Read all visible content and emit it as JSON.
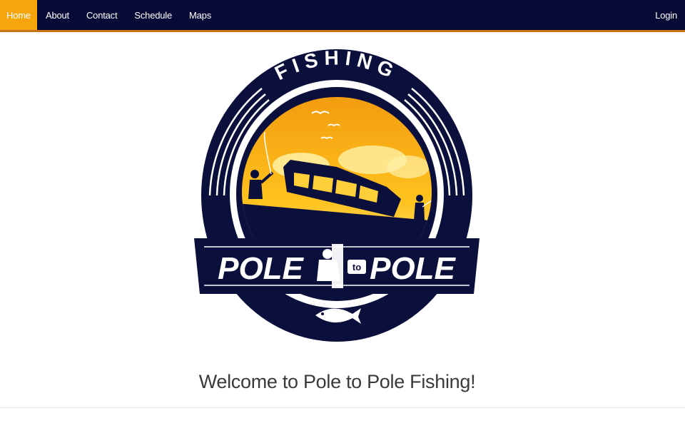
{
  "nav": {
    "items": [
      {
        "label": "Home",
        "active": true
      },
      {
        "label": "About"
      },
      {
        "label": "Contact"
      },
      {
        "label": "Schedule"
      },
      {
        "label": "Maps"
      }
    ],
    "login_label": "Login"
  },
  "logo": {
    "top_text": "FISHING",
    "left_word": "POLE",
    "middle_word": "to",
    "right_word": "POLE",
    "colors": {
      "navy": "#0b0f3c",
      "gold": "#f6a60c",
      "sky": "#ffd24a"
    }
  },
  "main": {
    "welcome_text": "Welcome to Pole to Pole Fishing!"
  }
}
